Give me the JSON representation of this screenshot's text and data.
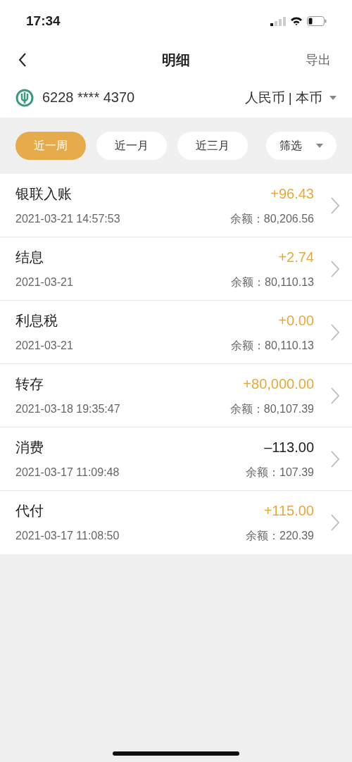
{
  "status_bar": {
    "time": "17:34"
  },
  "nav": {
    "title": "明细",
    "action": "导出"
  },
  "account": {
    "number": "6228 **** 4370",
    "currency": "人民币 | 本币"
  },
  "filters": [
    {
      "label": "近一周",
      "selected": true
    },
    {
      "label": "近一月",
      "selected": false
    },
    {
      "label": "近三月",
      "selected": false
    }
  ],
  "filter_menu": {
    "label": "筛选"
  },
  "transactions": [
    {
      "title": "银联入账",
      "amount": "+96.43",
      "kind": "credit",
      "date": "2021-03-21 14:57:53",
      "balance": "余额：80,206.56"
    },
    {
      "title": "结息",
      "amount": "+2.74",
      "kind": "credit",
      "date": "2021-03-21",
      "balance": "余额：80,110.13"
    },
    {
      "title": "利息税",
      "amount": "+0.00",
      "kind": "credit",
      "date": "2021-03-21",
      "balance": "余额：80,110.13"
    },
    {
      "title": "转存",
      "amount": "+80,000.00",
      "kind": "credit",
      "date": "2021-03-18 19:35:47",
      "balance": "余额：80,107.39"
    },
    {
      "title": "消费",
      "amount": "–113.00",
      "kind": "debit",
      "date": "2021-03-17 11:09:48",
      "balance": "余额：107.39"
    },
    {
      "title": "代付",
      "amount": "+115.00",
      "kind": "credit",
      "date": "2021-03-17 11:08:50",
      "balance": "余额：220.39"
    }
  ]
}
